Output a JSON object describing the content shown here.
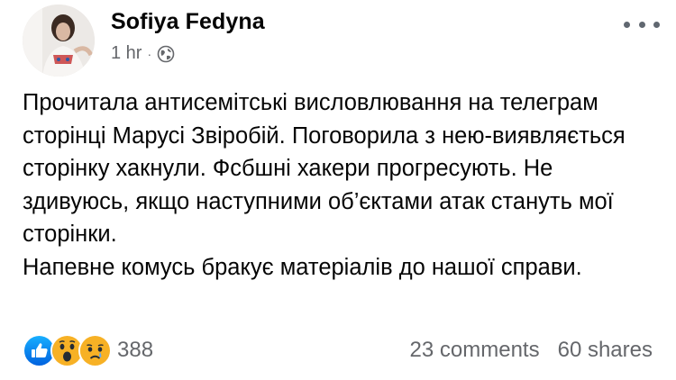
{
  "post": {
    "author": "Sofiya Fedyna",
    "time": "1 hr",
    "separator": "·",
    "privacy_icon": "globe-icon",
    "more_icon": "more-options-icon",
    "body": [
      "Прочитала антисемітські висловлювання на телеграм сторінці Марусі Звіробій. Поговорила з нею-виявляється сторінку хакнули. Фсбшні хакери прогресують. Не здивуюсь, якщо наступними об’єктами атак стануть мої сторінки.",
      "Напевне комусь бракує матеріалів до нашої справи."
    ]
  },
  "footer": {
    "reaction_icons": [
      "like-icon",
      "wow-icon",
      "sad-icon"
    ],
    "reaction_count": "388",
    "comments": "23 comments",
    "shares": "60 shares"
  },
  "colors": {
    "like_blue": "#1877F2",
    "emoji_yellow": "#F7B125",
    "meta_gray": "#65676B"
  }
}
